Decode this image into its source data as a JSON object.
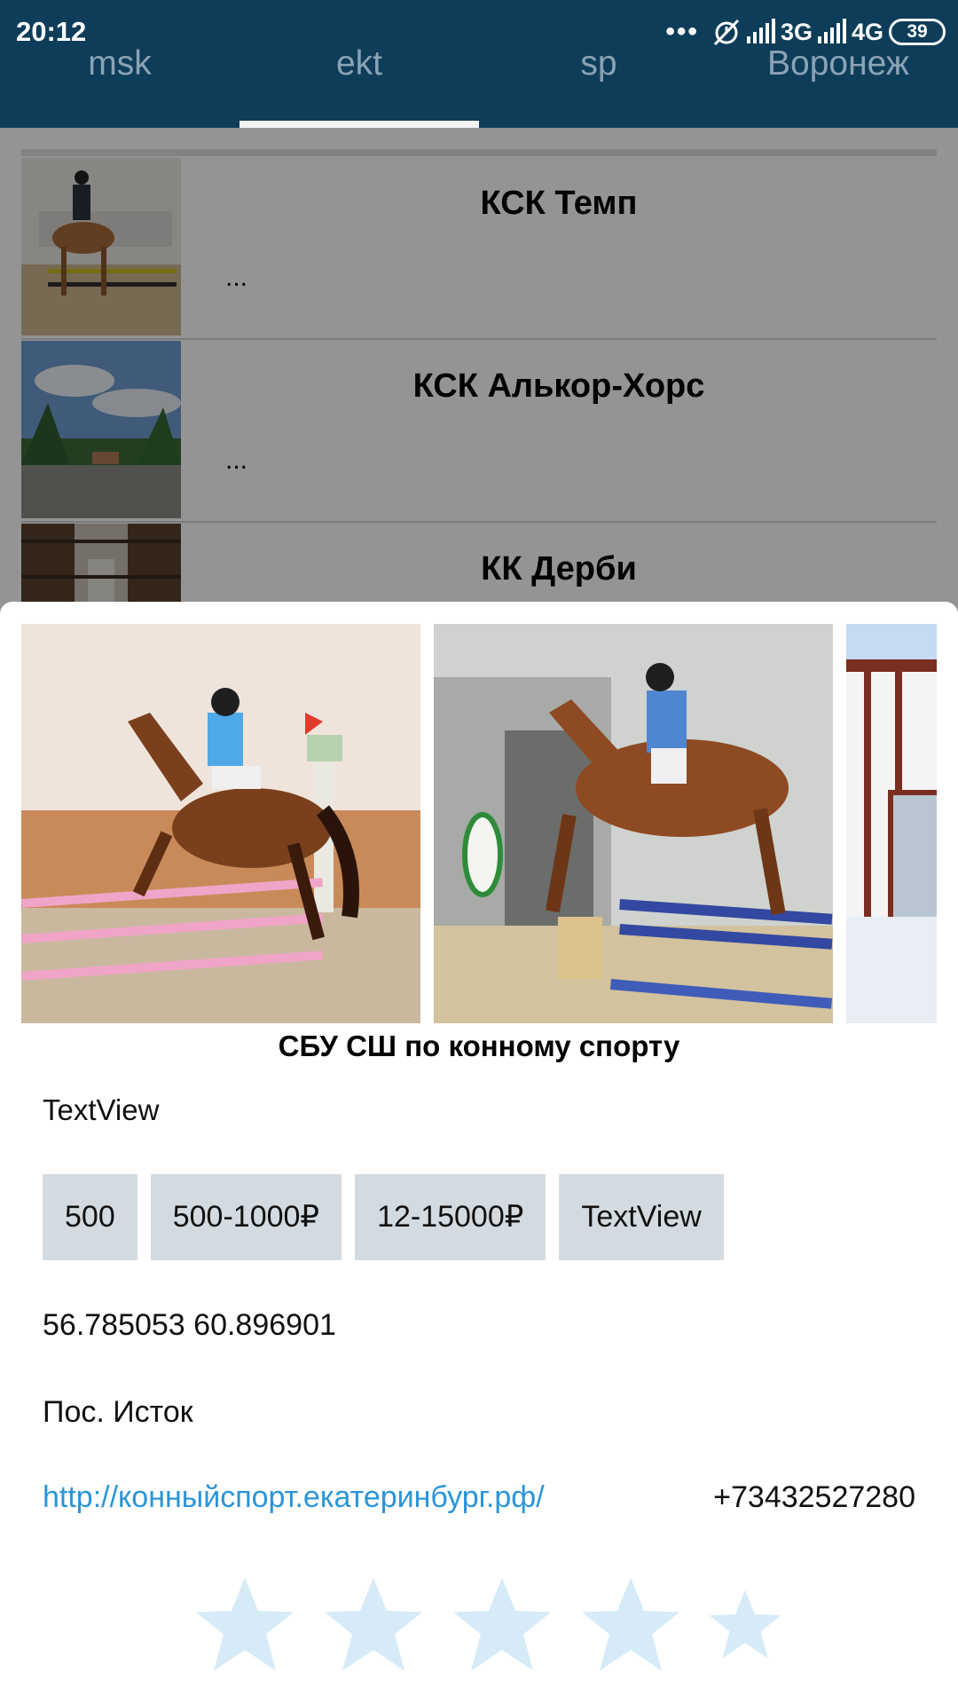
{
  "status_bar": {
    "time": "20:12",
    "dots": "•••",
    "network_1": "3G",
    "network_2": "4G",
    "battery": "39"
  },
  "tabs": [
    {
      "label": "msk",
      "active": false
    },
    {
      "label": "ekt",
      "active": true
    },
    {
      "label": "sp",
      "active": false
    },
    {
      "label": "Воронеж",
      "active": false
    }
  ],
  "list": [
    {
      "title": "КСК Темп",
      "description": "..."
    },
    {
      "title": "КСК Алькор-Хорс",
      "description": "..."
    },
    {
      "title": "КК Дерби",
      "description": ""
    }
  ],
  "detail": {
    "title": "СБУ СШ по конному спорту",
    "text_view": "TextView",
    "prices": [
      "500",
      "500-1000₽",
      "12-15000₽",
      "TextView"
    ],
    "coordinates": "56.785053 60.896901",
    "location": "Пос. Исток",
    "website": "http://конныйспорт.екатеринбург.рф/",
    "phone": "+73432527280",
    "rating": {
      "stars_total": 5,
      "star_color": "#d6ebf7"
    }
  },
  "colors": {
    "appbar": "#0e3d59",
    "tab_inactive": "#8aa3b5",
    "chip_bg": "#d3dbe0",
    "link": "#2b95d8"
  }
}
